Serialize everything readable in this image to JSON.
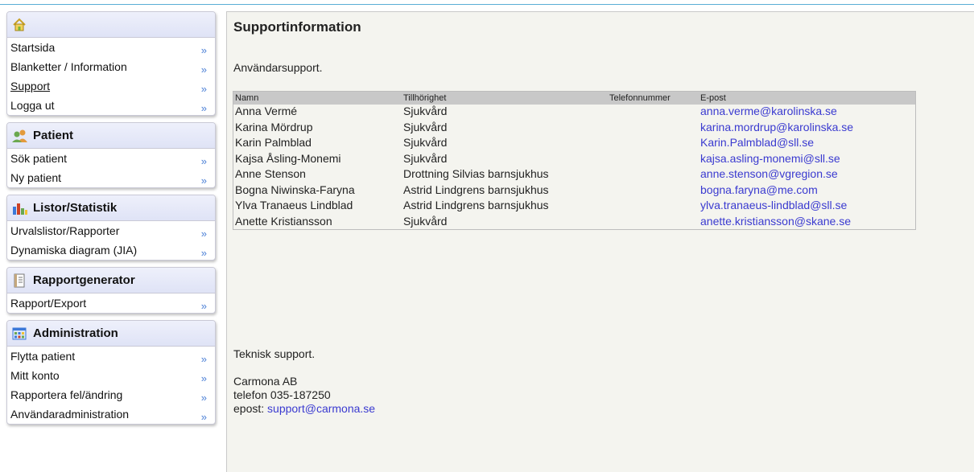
{
  "sidebar": {
    "home": {
      "items": [
        {
          "label": "Startsida"
        },
        {
          "label": "Blanketter / Information"
        },
        {
          "label": "Support"
        },
        {
          "label": "Logga ut"
        }
      ]
    },
    "patient": {
      "title": "Patient",
      "items": [
        {
          "label": "Sök patient"
        },
        {
          "label": "Ny patient"
        }
      ]
    },
    "listor": {
      "title": "Listor/Statistik",
      "items": [
        {
          "label": "Urvalslistor/Rapporter"
        },
        {
          "label": "Dynamiska diagram (JIA)"
        }
      ]
    },
    "rapportgenerator": {
      "title": "Rapportgenerator",
      "items": [
        {
          "label": "Rapport/Export"
        }
      ]
    },
    "administration": {
      "title": "Administration",
      "items": [
        {
          "label": "Flytta patient"
        },
        {
          "label": "Mitt konto"
        },
        {
          "label": "Rapportera fel/ändring"
        },
        {
          "label": "Användaradministration"
        }
      ]
    },
    "chevron": "»"
  },
  "main": {
    "title": "Supportinformation",
    "intro": "Användarsupport.",
    "table": {
      "headers": [
        "Namn",
        "Tillhörighet",
        "Telefonnummer",
        "E-post"
      ],
      "rows": [
        [
          "Anna Vermé",
          "Sjukvård",
          "",
          "anna.verme@karolinska.se"
        ],
        [
          "Karina Mördrup",
          "Sjukvård",
          "",
          "karina.mordrup@karolinska.se"
        ],
        [
          "Karin Palmblad",
          "Sjukvård",
          "",
          "Karin.Palmblad@sll.se"
        ],
        [
          "Kajsa Åsling-Monemi",
          "Sjukvård",
          "",
          "kajsa.asling-monemi@sll.se"
        ],
        [
          "Anne Stenson",
          "Drottning Silvias barnsjukhus",
          "",
          "anne.stenson@vgregion.se"
        ],
        [
          "Bogna Niwinska-Faryna",
          "Astrid Lindgrens barnsjukhus",
          "",
          "bogna.faryna@me.com"
        ],
        [
          "Ylva Tranaeus Lindblad",
          "Astrid Lindgrens barnsjukhus",
          "",
          "ylva.tranaeus-lindblad@sll.se"
        ],
        [
          "Anette Kristiansson",
          "Sjukvård",
          "",
          "anette.kristiansson@skane.se"
        ]
      ]
    },
    "tech": {
      "heading": "Teknisk support.",
      "company": "Carmona AB",
      "phone": "telefon 035-187250",
      "email_prefix": "epost:",
      "email": "support@carmona.se"
    }
  },
  "colors": {
    "link": "#3a3ad0",
    "chevron": "#4a7fd6",
    "header_bg": "#dfe3f6",
    "main_bg": "#f4f4ef"
  }
}
